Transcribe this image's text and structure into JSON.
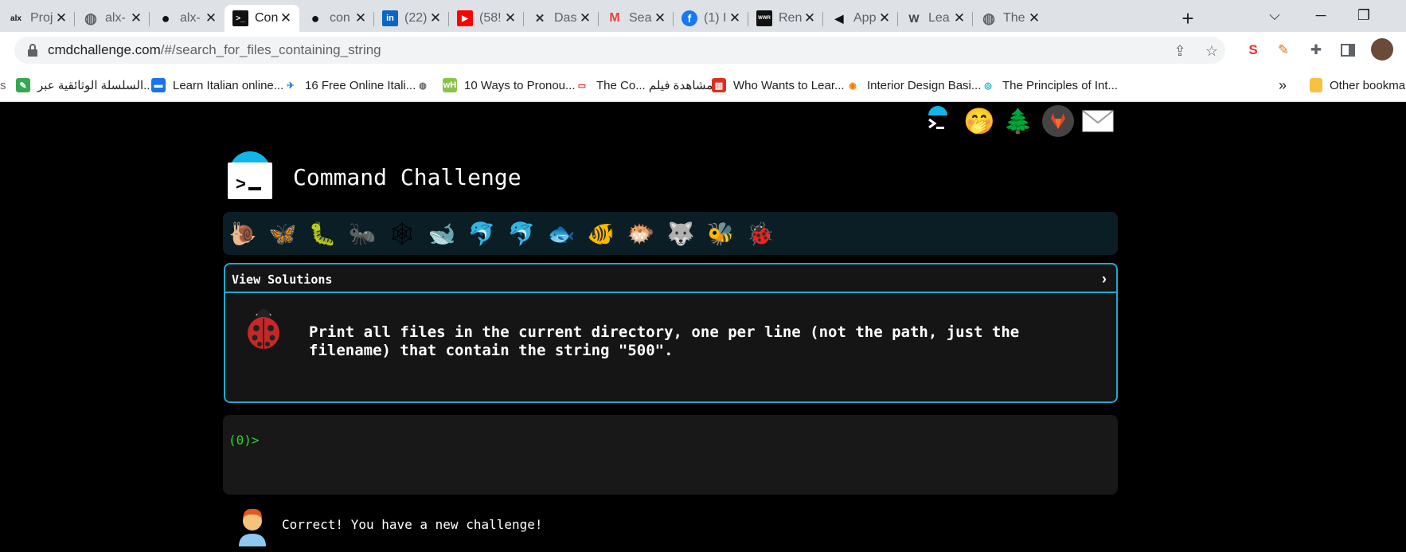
{
  "browser": {
    "tabs": [
      {
        "icon": "alx-icon",
        "label": "Proj",
        "active": false
      },
      {
        "icon": "globe-icon",
        "label": "alx-",
        "active": false
      },
      {
        "icon": "github-icon",
        "label": "alx-",
        "active": false
      },
      {
        "icon": "terminal-icon",
        "label": "Con",
        "active": true
      },
      {
        "icon": "github-icon",
        "label": "con",
        "active": false
      },
      {
        "icon": "linkedin-icon",
        "label": "(22)",
        "active": false
      },
      {
        "icon": "youtube-icon",
        "label": "(58!",
        "active": false
      },
      {
        "icon": "dashboard-icon",
        "label": "Das",
        "active": false
      },
      {
        "icon": "gmail-icon",
        "label": "Sea",
        "active": false
      },
      {
        "icon": "facebook-icon",
        "label": "(1) I",
        "active": false
      },
      {
        "icon": "wwr-icon",
        "label": "Ren",
        "active": false
      },
      {
        "icon": "megaphone-icon",
        "label": "App",
        "active": false
      },
      {
        "icon": "wordpress-icon",
        "label": "Lea",
        "active": false
      },
      {
        "icon": "globe-icon",
        "label": "The",
        "active": false
      }
    ],
    "new_tab_glyph": "+",
    "url_host": "cmdchallenge.com",
    "url_path": "/#/search_for_files_containing_string",
    "bookmarks": [
      {
        "icon": "green-note-icon",
        "label": "السلسلة الوثائقية عبر..."
      },
      {
        "icon": "blue-flag-icon",
        "label": "Learn Italian online..."
      },
      {
        "icon": "map-icon",
        "label": "16 Free Online Itali..."
      },
      {
        "icon": "globe-icon",
        "label": ""
      },
      {
        "icon": "wh-icon",
        "label": "10 Ways to Pronou..."
      },
      {
        "icon": "site-icon",
        "label": "The Co... مشاهدة فيلم"
      },
      {
        "icon": "red-box-icon",
        "label": "Who Wants to Lear..."
      },
      {
        "icon": "play-icon",
        "label": "Interior Design Basi..."
      },
      {
        "icon": "teal-circle-icon",
        "label": "The Principles of Int..."
      }
    ],
    "more_bookmarks_glyph": "»",
    "other_bookmarks_label": "Other bookma"
  },
  "site": {
    "title": "Command Challenge",
    "critters": [
      "🐌",
      "🦋",
      "🐛",
      "🐜",
      "🕸",
      "🐋",
      "🐬",
      "🐬",
      "🐟",
      "🐠",
      "🐡",
      "🐺",
      "🐝",
      "🐞"
    ],
    "panel_header": "View Solutions",
    "panel_arrow": "›",
    "challenge_text": "Print all files in the current directory, one per line (not the path, just the filename) that contain the string \"500\".",
    "prompt": "(0)>",
    "feedback": "Correct! You have a new challenge!"
  },
  "colors": {
    "accent": "#1fa9d0",
    "prompt_green": "#2bd62b",
    "page_bg": "#000000"
  }
}
